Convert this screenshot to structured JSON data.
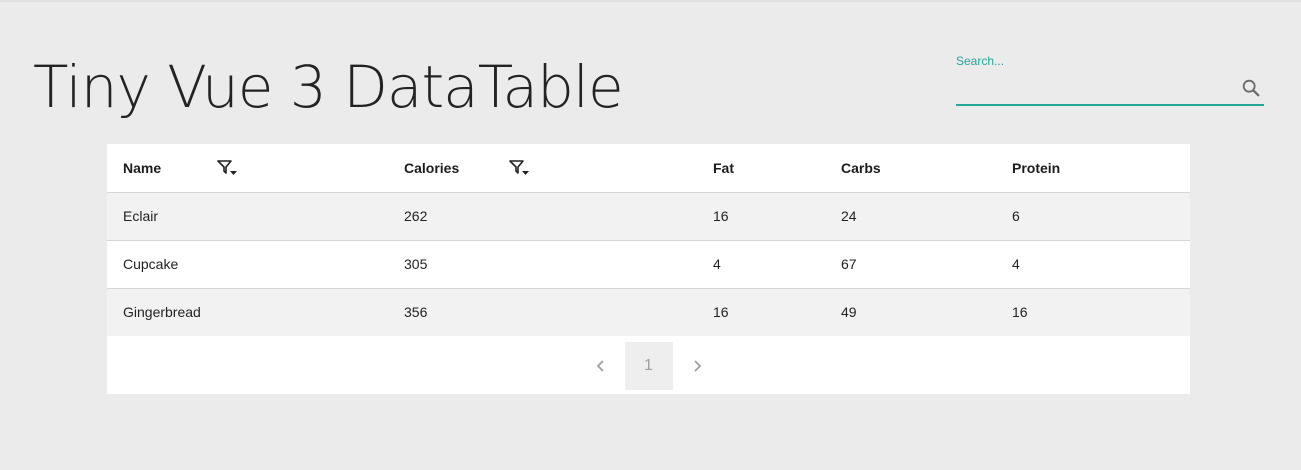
{
  "header": {
    "title": "Tiny Vue 3 DataTable"
  },
  "search": {
    "label": "Search...",
    "value": "",
    "icon": "search-icon"
  },
  "table": {
    "columns": [
      {
        "label": "Name",
        "filterable": true
      },
      {
        "label": "Calories",
        "filterable": true
      },
      {
        "label": "Fat",
        "filterable": false
      },
      {
        "label": "Carbs",
        "filterable": false
      },
      {
        "label": "Protein",
        "filterable": false
      }
    ],
    "rows": [
      [
        "Eclair",
        "262",
        "16",
        "24",
        "6"
      ],
      [
        "Cupcake",
        "305",
        "4",
        "67",
        "4"
      ],
      [
        "Gingerbread",
        "356",
        "16",
        "49",
        "16"
      ]
    ]
  },
  "pagination": {
    "prev_icon": "chevron-left-icon",
    "current_page": "1",
    "next_icon": "chevron-right-icon"
  },
  "colors": {
    "accent": "#26a69a",
    "background": "#ebebeb",
    "stripe": "#f2f2f2"
  }
}
